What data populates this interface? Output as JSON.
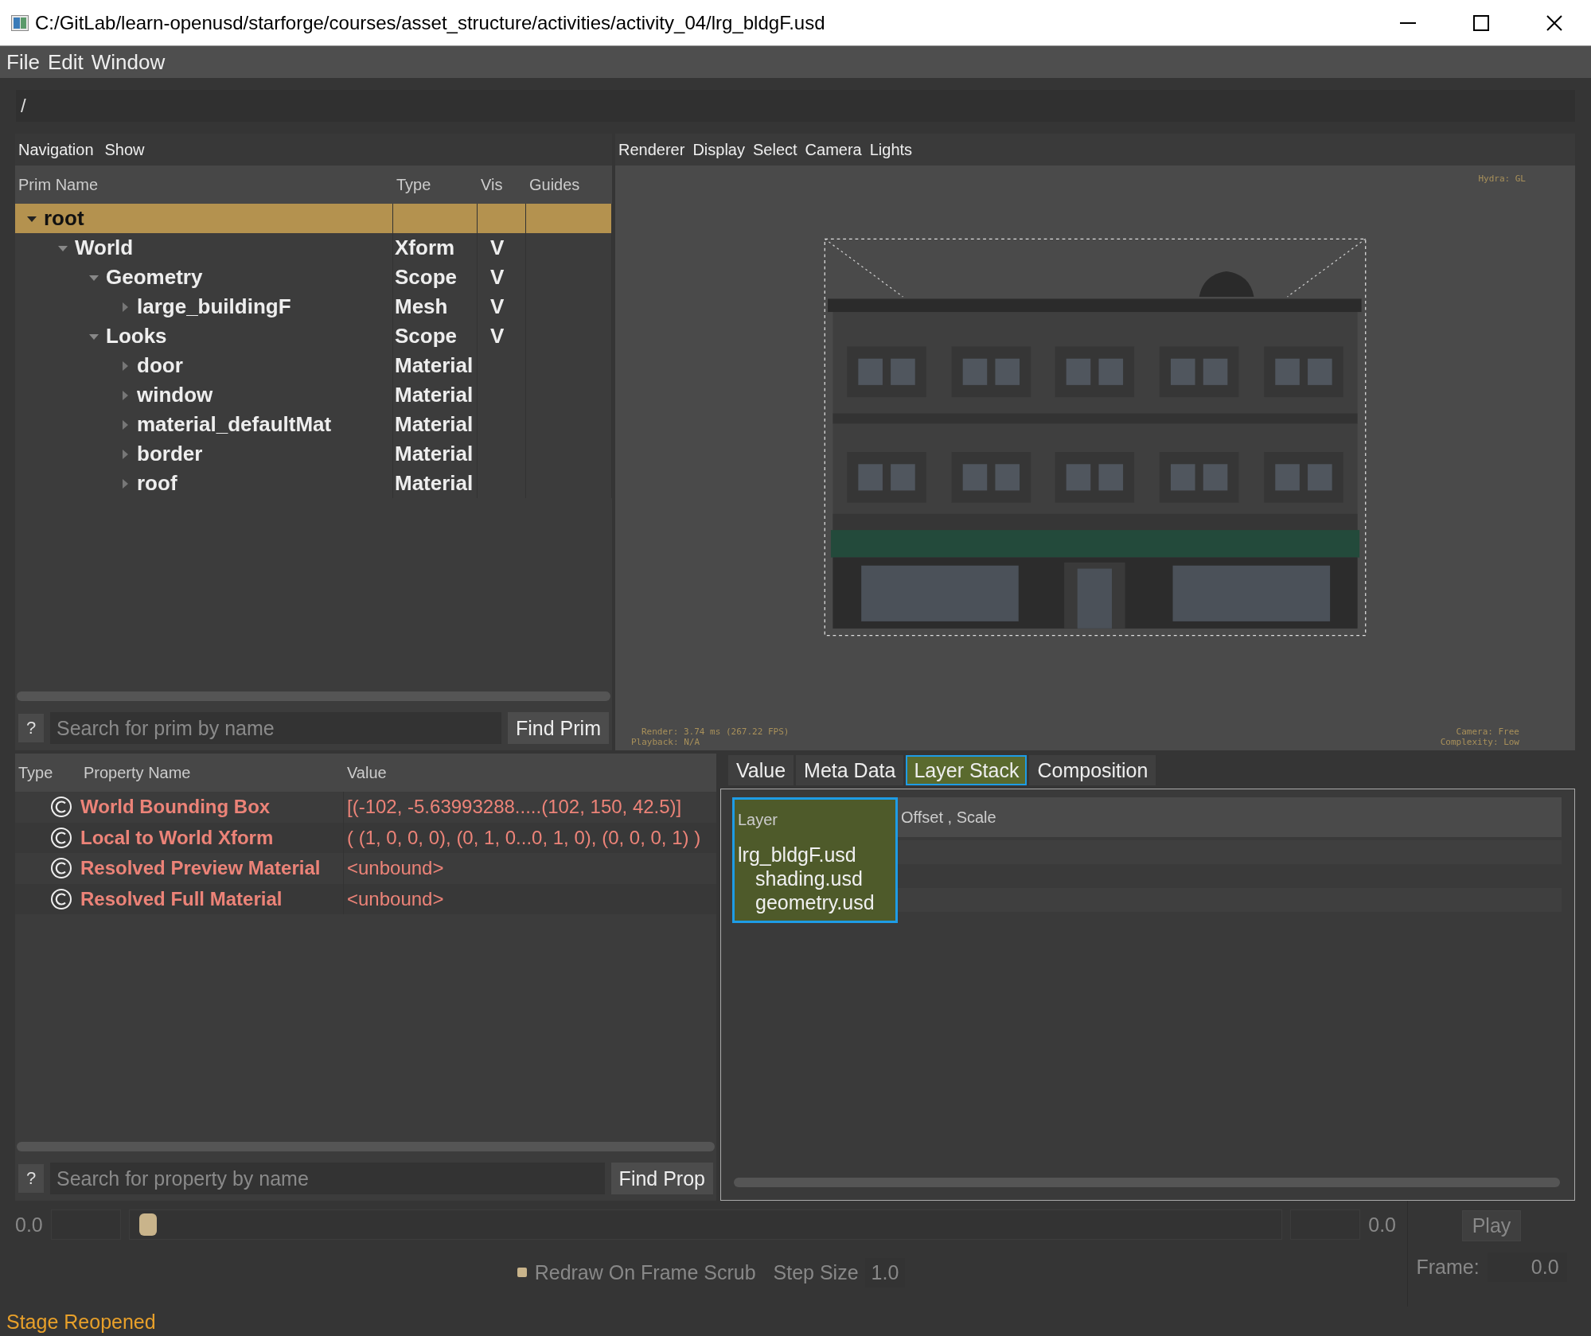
{
  "window": {
    "title": "C:/GitLab/learn-openusd/starforge/courses/asset_structure/activities/activity_04/lrg_bldgF.usd"
  },
  "menu_bar": [
    "File",
    "Edit",
    "Window"
  ],
  "path_field": {
    "value": "/"
  },
  "prim_panel": {
    "menu": [
      "Navigation",
      "Show"
    ],
    "columns": [
      "Prim Name",
      "Type",
      "Vis",
      "Guides"
    ],
    "tree": [
      {
        "name": "root",
        "expanded": true,
        "selected": true,
        "children": [
          {
            "name": "World",
            "type": "Xform",
            "vis": "V",
            "expanded": true,
            "selected": false,
            "children": [
              {
                "name": "Geometry",
                "type": "Scope",
                "vis": "V",
                "expanded": true,
                "selected": false,
                "children": [
                  {
                    "name": "large_buildingF",
                    "type": "Mesh",
                    "vis": "V",
                    "expanded": false,
                    "selected": false
                  }
                ]
              },
              {
                "name": "Looks",
                "type": "Scope",
                "vis": "V",
                "expanded": true,
                "selected": false,
                "children": [
                  {
                    "name": "door",
                    "type": "Material",
                    "expanded": false,
                    "selected": false
                  },
                  {
                    "name": "window",
                    "type": "Material",
                    "expanded": false,
                    "selected": false
                  },
                  {
                    "name": "material_defaultMat",
                    "type": "Material",
                    "expanded": false,
                    "selected": false
                  },
                  {
                    "name": "border",
                    "type": "Material",
                    "expanded": false,
                    "selected": false
                  },
                  {
                    "name": "roof",
                    "type": "Material",
                    "expanded": false,
                    "selected": false
                  }
                ]
              }
            ]
          }
        ]
      }
    ],
    "help_button": "?",
    "search": {
      "placeholder": "Search for prim by name"
    },
    "find_button": "Find Prim"
  },
  "viewport": {
    "menu": [
      "Renderer",
      "Display",
      "Select",
      "Camera",
      "Lights"
    ],
    "hud_top_right": [
      "Hydra: GL"
    ],
    "hud_bottom_left": [
      "Render: 3.74 ms (267.22 FPS)",
      "Playback: N/A"
    ],
    "hud_bottom_right": [
      "Camera: Free",
      "Complexity: Low"
    ]
  },
  "property_panel": {
    "columns": [
      "Type",
      "Property Name",
      "Value"
    ],
    "rows": [
      {
        "name": "World Bounding Box",
        "value": "[(-102, -5.63993288.....(102, 150, 42.5)]"
      },
      {
        "name": "Local to World Xform",
        "value": "( (1, 0, 0, 0), (0, 1, 0...0, 1, 0), (0, 0, 0, 1) )"
      },
      {
        "name": "Resolved Preview Material",
        "value": "<unbound>"
      },
      {
        "name": "Resolved Full Material",
        "value": "<unbound>"
      }
    ],
    "help_button": "?",
    "search": {
      "placeholder": "Search for property by name"
    },
    "find_button": "Find Prop"
  },
  "detail_panel": {
    "tabs": [
      {
        "label": "Value",
        "selected": false
      },
      {
        "label": "Meta Data",
        "selected": false
      },
      {
        "label": "Layer Stack",
        "selected": true
      },
      {
        "label": "Composition",
        "selected": false
      }
    ],
    "columns": [
      {
        "label": "Layer",
        "selected": true
      },
      {
        "label": "Offset , Scale",
        "selected": false
      }
    ],
    "layers": [
      {
        "name": "lrg_bldgF.usd",
        "children": [
          {
            "name": "shading.usd"
          },
          {
            "name": "geometry.usd"
          }
        ]
      }
    ]
  },
  "timeline": {
    "start": "0.0",
    "end": "0.0",
    "level": 0,
    "play_button": "Play",
    "redraw_checkbox": {
      "label": "Redraw On Frame Scrub",
      "checked": true
    },
    "step_size": {
      "label": "Step Size",
      "value": "1.0"
    },
    "frame": {
      "label": "Frame:",
      "value": "0.0"
    }
  },
  "status_bar": {
    "message": "Stage Reopened"
  }
}
